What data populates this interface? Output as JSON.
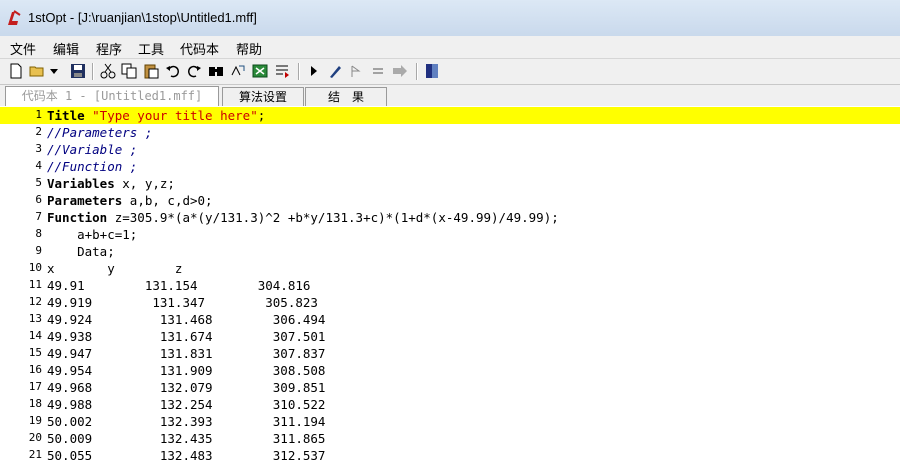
{
  "window": {
    "title": "1stOpt - [J:\\ruanjian\\1stop\\Untitled1.mff]"
  },
  "menu": [
    "文件",
    "编辑",
    "程序",
    "工具",
    "代码本",
    "帮助"
  ],
  "toolbar_icons": [
    "new-file-icon",
    "open-folder-icon",
    "dropdown-arrow-icon",
    "save-icon",
    "cut-icon",
    "copy-icon",
    "paste-icon",
    "undo-icon",
    "redo-icon",
    "find-icon",
    "replace-icon",
    "export-icon",
    "import-icon",
    "run-icon",
    "debug-icon",
    "step-icon",
    "equals-icon",
    "forward-icon",
    "book-icon"
  ],
  "tabs": [
    {
      "label": "代码本 1 - [Untitled1.mff]"
    },
    {
      "label": "算法设置"
    },
    {
      "label": "结　果"
    }
  ],
  "code_lines": [
    {
      "n": "1",
      "kw": "Title ",
      "rest": "",
      "str": "\"Type your title here\"",
      "tail": ";",
      "cmt": ""
    },
    {
      "n": "2",
      "kw": "",
      "rest": "",
      "str": "",
      "tail": "",
      "cmt": "//Parameters ;"
    },
    {
      "n": "3",
      "kw": "",
      "rest": "",
      "str": "",
      "tail": "",
      "cmt": "//Variable ;"
    },
    {
      "n": "4",
      "kw": "",
      "rest": "",
      "str": "",
      "tail": "",
      "cmt": "//Function ;"
    },
    {
      "n": "5",
      "kw": "Variables ",
      "rest": "x, y,z;",
      "str": "",
      "tail": "",
      "cmt": ""
    },
    {
      "n": "6",
      "kw": "Parameters ",
      "rest": "a,b, c,d>0;",
      "str": "",
      "tail": "",
      "cmt": ""
    },
    {
      "n": "7",
      "kw": "Function ",
      "rest": "z=305.9*(a*(y/131.3)^2 +b*y/131.3+c)*(1+d*(x-49.99)/49.99);",
      "str": "",
      "tail": "",
      "cmt": ""
    },
    {
      "n": "8",
      "kw": "",
      "rest": "    a+b+c=1;",
      "str": "",
      "tail": "",
      "cmt": ""
    },
    {
      "n": "9",
      "kw": "",
      "rest": "    Data;",
      "str": "",
      "tail": "",
      "cmt": ""
    },
    {
      "n": "10",
      "kw": "",
      "rest": "x       y        z",
      "str": "",
      "tail": "",
      "cmt": ""
    },
    {
      "n": "11",
      "kw": "",
      "rest": "49.91        131.154        304.816",
      "str": "",
      "tail": "",
      "cmt": ""
    },
    {
      "n": "12",
      "kw": "",
      "rest": "49.919        131.347        305.823",
      "str": "",
      "tail": "",
      "cmt": ""
    },
    {
      "n": "13",
      "kw": "",
      "rest": "49.924         131.468        306.494",
      "str": "",
      "tail": "",
      "cmt": ""
    },
    {
      "n": "14",
      "kw": "",
      "rest": "49.938         131.674        307.501",
      "str": "",
      "tail": "",
      "cmt": ""
    },
    {
      "n": "15",
      "kw": "",
      "rest": "49.947         131.831        307.837",
      "str": "",
      "tail": "",
      "cmt": ""
    },
    {
      "n": "16",
      "kw": "",
      "rest": "49.954         131.909        308.508",
      "str": "",
      "tail": "",
      "cmt": ""
    },
    {
      "n": "17",
      "kw": "",
      "rest": "49.968         132.079        309.851",
      "str": "",
      "tail": "",
      "cmt": ""
    },
    {
      "n": "18",
      "kw": "",
      "rest": "49.988         132.254        310.522",
      "str": "",
      "tail": "",
      "cmt": ""
    },
    {
      "n": "19",
      "kw": "",
      "rest": "50.002         132.393        311.194",
      "str": "",
      "tail": "",
      "cmt": ""
    },
    {
      "n": "20",
      "kw": "",
      "rest": "50.009         132.435        311.865",
      "str": "",
      "tail": "",
      "cmt": ""
    },
    {
      "n": "21",
      "kw": "",
      "rest": "50.055         132.483        312.537",
      "str": "",
      "tail": "",
      "cmt": ""
    }
  ],
  "colors": {
    "highlight": "#ffff00",
    "string": "#cc0000",
    "comment": "#000080"
  }
}
